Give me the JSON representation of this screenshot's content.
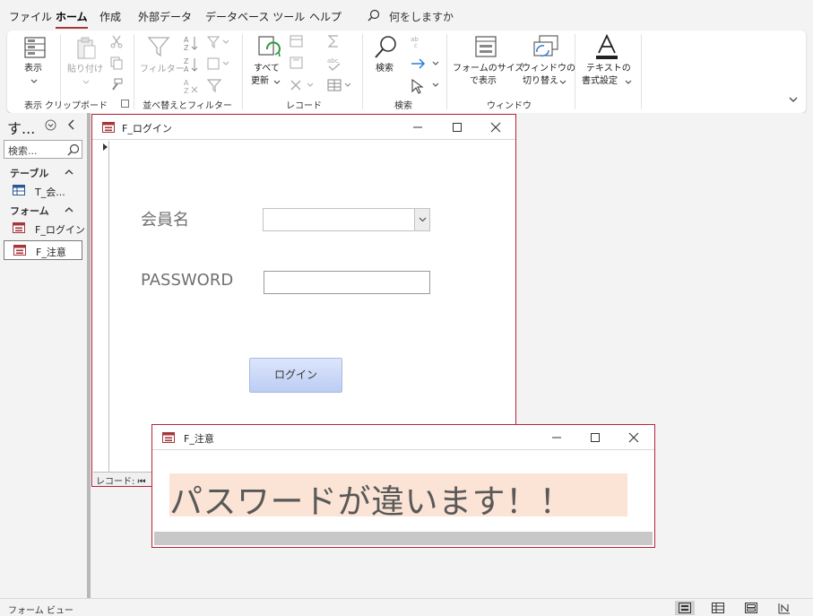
{
  "menu": {
    "tabs": [
      "ファイル",
      "ホーム",
      "作成",
      "外部データ",
      "データベース ツール",
      "ヘルプ"
    ],
    "active_tab": "ホーム",
    "tell_me": "何をしますか"
  },
  "ribbon": {
    "view_btn": "表示",
    "paste_btn": "貼り付け",
    "filter_btn": "フィルター",
    "refresh_btn": "すべて",
    "refresh_btn_line2": "更新",
    "find_btn": "検索",
    "fit_form_line1": "フォームのサイズ",
    "fit_form_line2": "で表示",
    "switch_windows_line1": "ウィンドウの",
    "switch_windows_line2": "切り替え",
    "text_format_line1": "テキストの",
    "text_format_line2": "書式設定",
    "groups": {
      "views": "表示",
      "clipboard": "クリップボード",
      "sort_filter": "並べ替えとフィルター",
      "records": "レコード",
      "find": "検索",
      "window": "ウィンドウ"
    }
  },
  "nav": {
    "title": "す...",
    "search_placeholder": "検索...",
    "group_tables": "テーブル",
    "group_forms": "フォーム",
    "items": [
      {
        "label": "T_会..."
      },
      {
        "label": "F_ログイン"
      },
      {
        "label": "F_注意"
      }
    ]
  },
  "login_form": {
    "title": "F_ログイン",
    "member_label": "会員名",
    "member_value": "",
    "password_label": "PASSWORD",
    "password_value": "",
    "login_button": "ログイン",
    "record_nav": "レコード: ⏮"
  },
  "alert_form": {
    "title": "F_注意",
    "message": "パスワードが違います！！"
  },
  "status": {
    "text": "フォーム ビュー"
  },
  "colors": {
    "accent": "#a4373a",
    "window_border": "#b4243d",
    "alert_bg": "#fbe4d5",
    "button_top": "#dce6fb",
    "button_bottom": "#bcccf4"
  }
}
